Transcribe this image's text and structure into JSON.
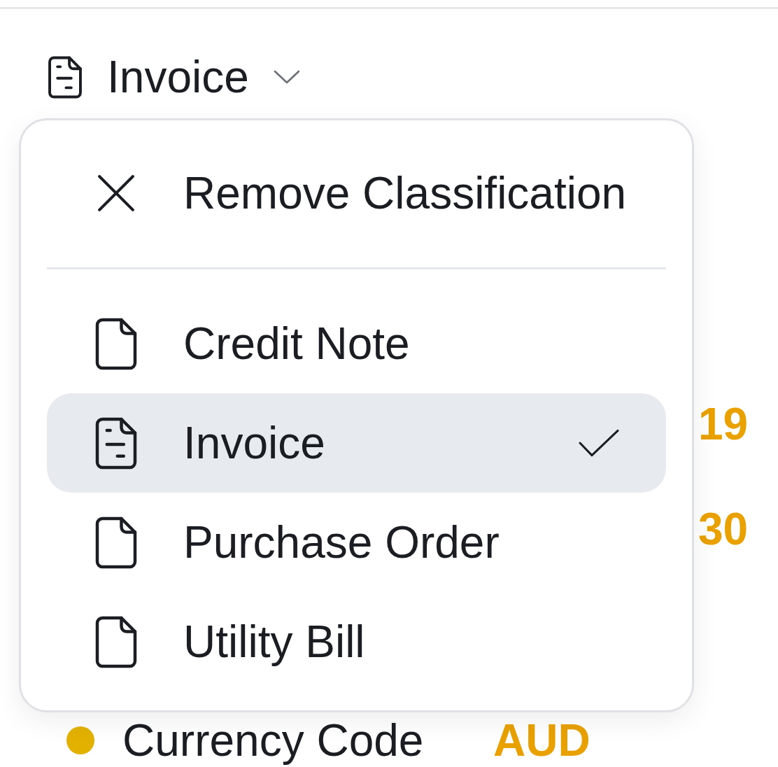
{
  "trigger": {
    "label": "Invoice"
  },
  "menu": {
    "remove_item": {
      "label": "Remove Classification"
    },
    "options": [
      {
        "label": "Credit Note",
        "selected": false
      },
      {
        "label": "Invoice",
        "selected": true
      },
      {
        "label": "Purchase Order",
        "selected": false
      },
      {
        "label": "Utility Bill",
        "selected": false
      }
    ]
  },
  "fields": [
    {
      "kind": "clipped",
      "value": "19"
    },
    {
      "kind": "clipped",
      "value": "30"
    },
    {
      "kind": "full",
      "label": "Currency Code",
      "value": "AUD"
    }
  ]
}
